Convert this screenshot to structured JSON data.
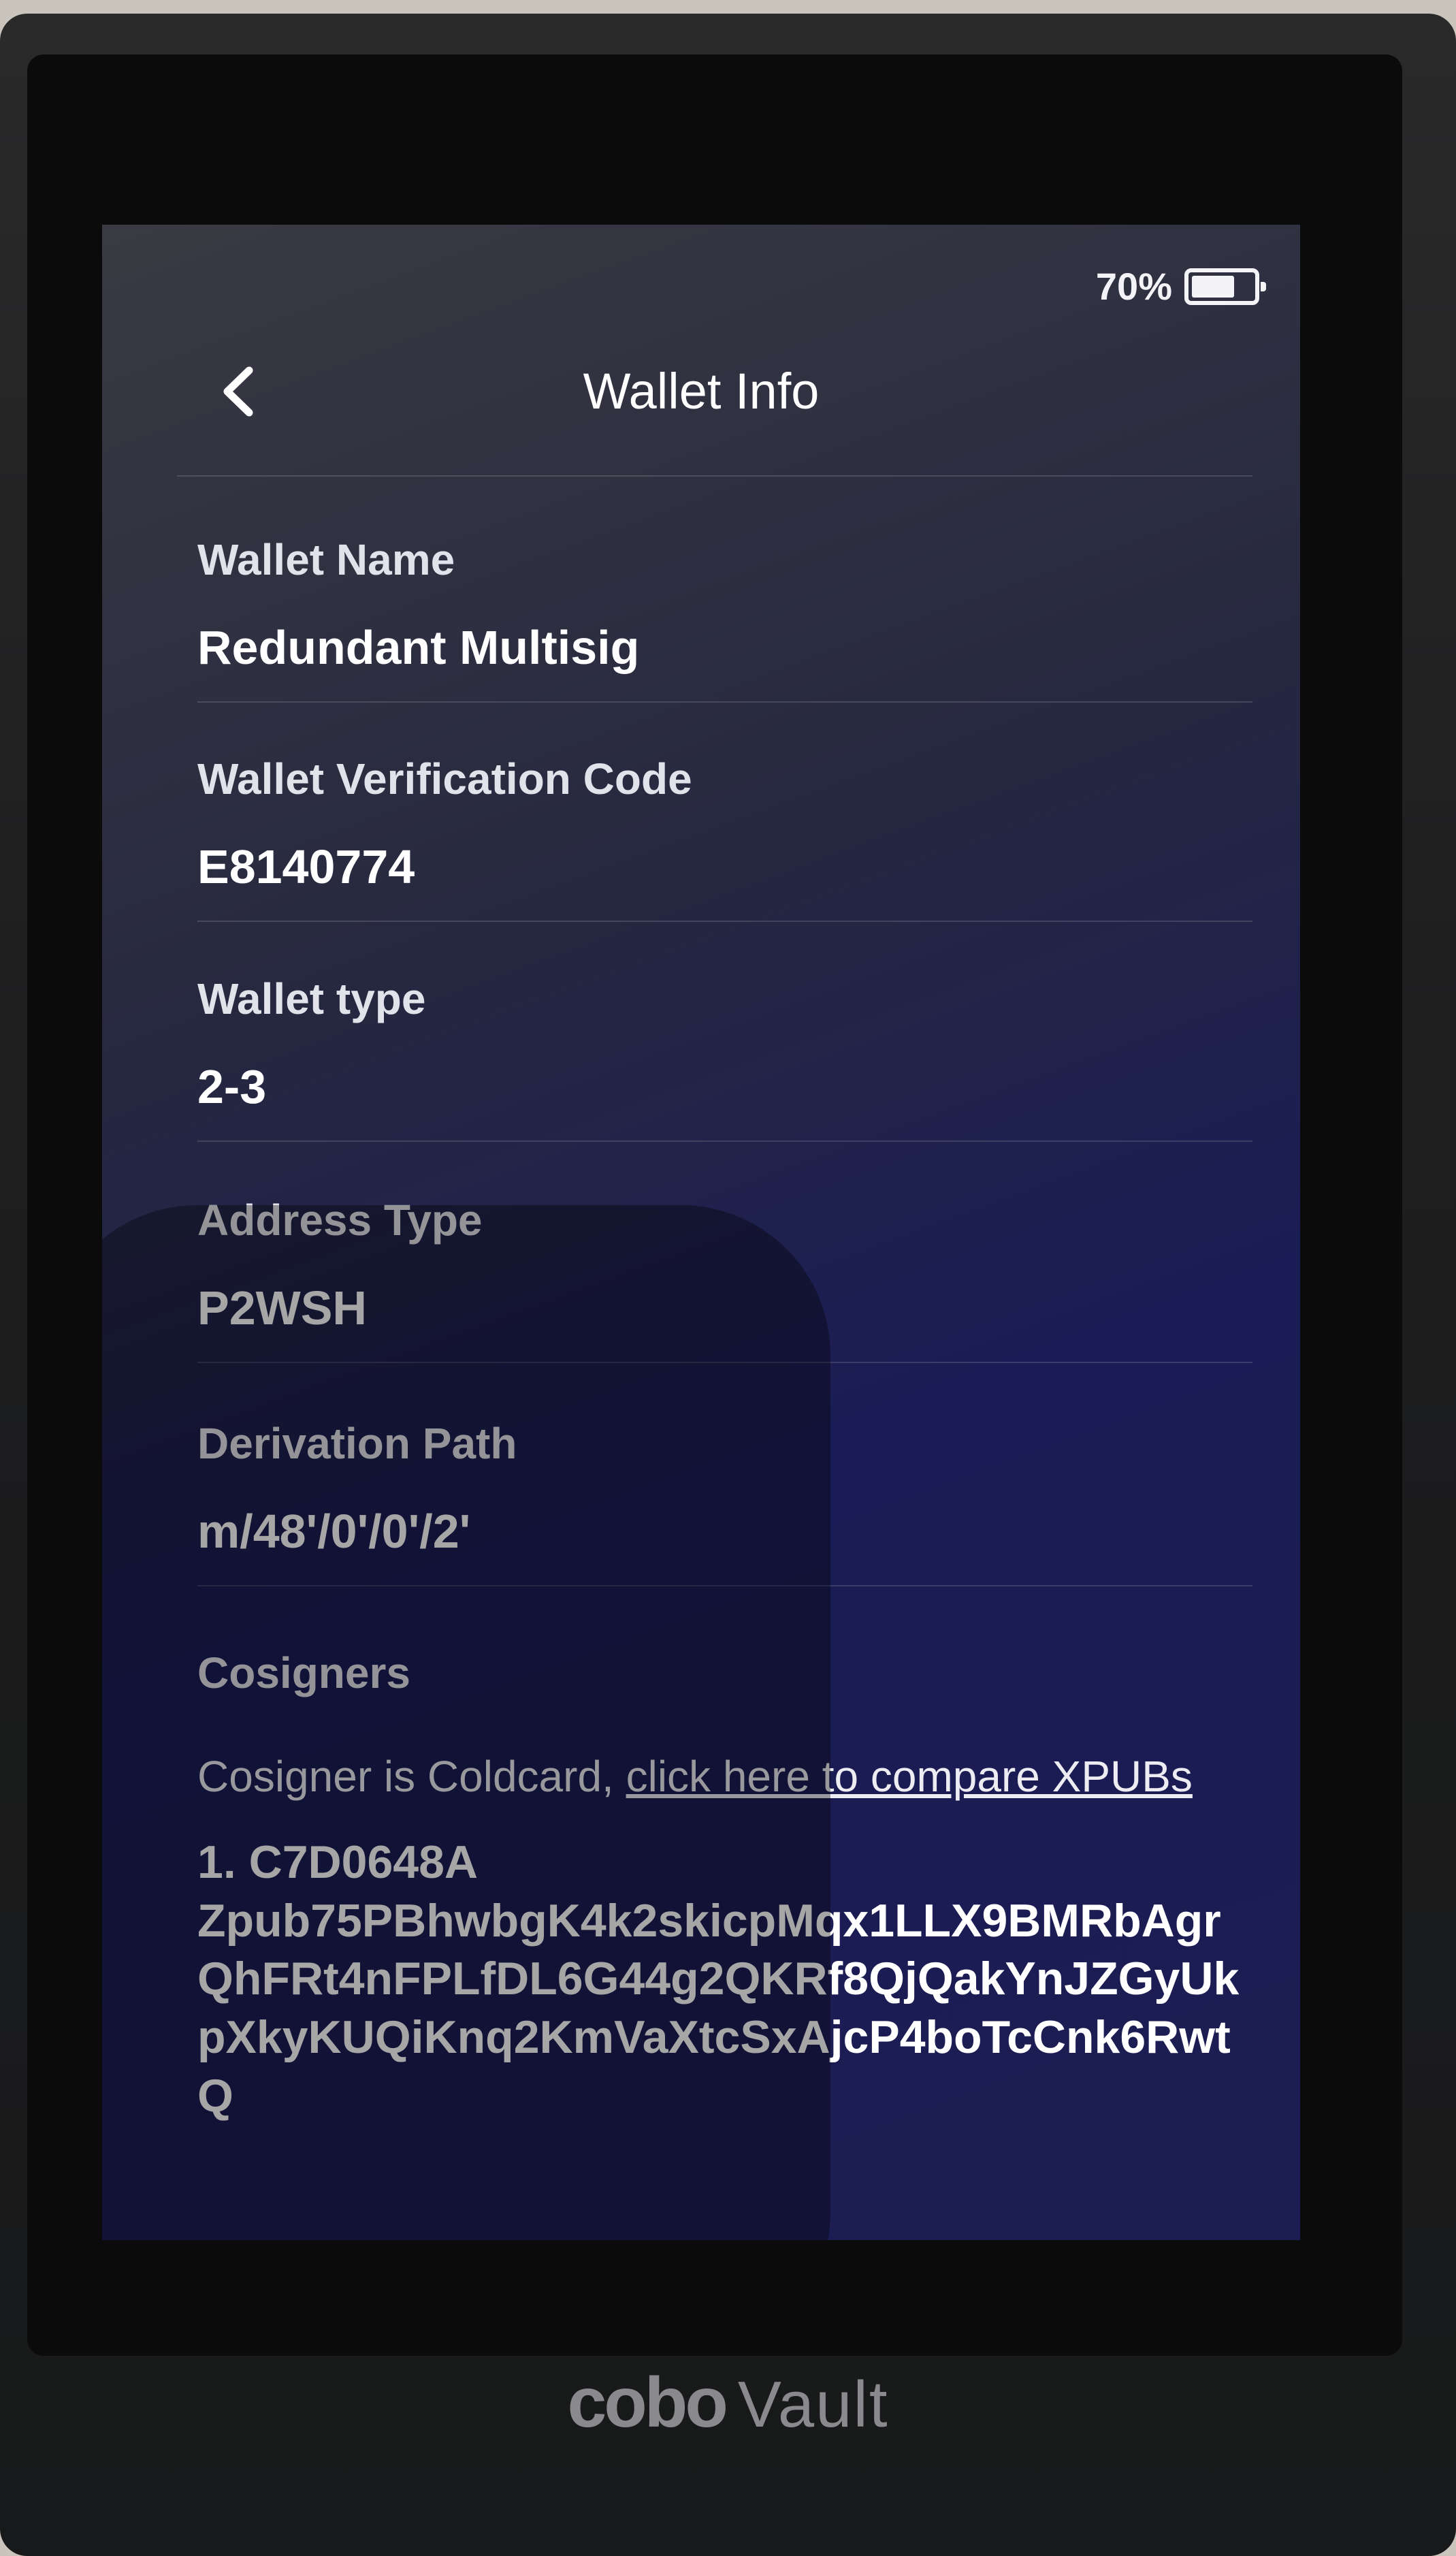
{
  "status": {
    "battery_text": "70%",
    "battery_level": 0.7,
    "battery_icon": "battery-icon"
  },
  "header": {
    "title": "Wallet Info",
    "back_icon": "chevron-left-icon"
  },
  "fields": [
    {
      "label": "Wallet Name",
      "value": "Redundant Multisig"
    },
    {
      "label": "Wallet Verification Code",
      "value": "E8140774"
    },
    {
      "label": "Wallet type",
      "value": "2-3"
    },
    {
      "label": "Address Type",
      "value": "P2WSH"
    },
    {
      "label": "Derivation Path",
      "value": "m/48'/0'/0'/2'"
    }
  ],
  "cosigners": {
    "label": "Cosigners",
    "note_prefix": "Cosigner is Coldcard, ",
    "compare_link": "click here to compare XPUBs",
    "entries": [
      {
        "index_fingerprint": "1. C7D0648A",
        "xpub": "Zpub75PBhwbgK4k2skicpMqx1LLX9BMRbAgrQhFRt4nFPLfDL6G44g2QKRf8QjQakYnJZGyUkpXkyKUQiKnq2KmVaXtcSxAjcP4boTcCnk6RwtQ"
      }
    ]
  },
  "device": {
    "brand_mark": "cobo",
    "brand_name": "Vault"
  }
}
